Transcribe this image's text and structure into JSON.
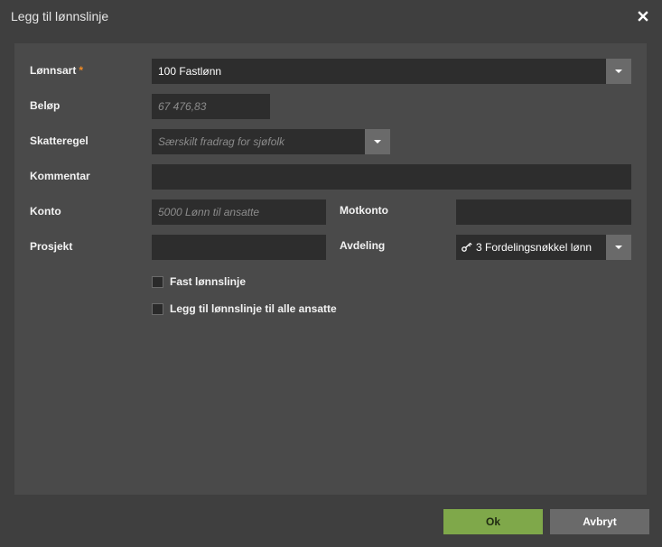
{
  "dialog": {
    "title": "Legg til lønnslinje",
    "close_icon": "close-icon"
  },
  "form": {
    "lonnsart": {
      "label": "Lønnsart",
      "required_marker": "*",
      "value": "100 Fastlønn",
      "dropdown_icon": "chevron-down-icon"
    },
    "belop": {
      "label": "Beløp",
      "placeholder": "67 476,83"
    },
    "skatteregel": {
      "label": "Skatteregel",
      "placeholder": "Særskilt fradrag for sjøfolk",
      "dropdown_icon": "chevron-down-icon"
    },
    "kommentar": {
      "label": "Kommentar",
      "value": ""
    },
    "konto": {
      "label": "Konto",
      "placeholder": "5000 Lønn til ansatte"
    },
    "motkonto": {
      "label": "Motkonto",
      "value": ""
    },
    "prosjekt": {
      "label": "Prosjekt",
      "value": ""
    },
    "avdeling": {
      "label": "Avdeling",
      "value": "3 Fordelingsnøkkel lønn",
      "icon": "key-icon",
      "dropdown_icon": "chevron-down-icon"
    },
    "checkboxes": [
      {
        "label": "Fast lønnslinje",
        "checked": false
      },
      {
        "label": "Legg til lønnslinje til alle ansatte",
        "checked": false
      }
    ]
  },
  "footer": {
    "ok_label": "Ok",
    "cancel_label": "Avbryt"
  },
  "colors": {
    "background": "#3f3f3f",
    "panel": "#4a4a4a",
    "field": "#2d2d2d",
    "accent_ok": "#7fa84a",
    "required": "#f08a24"
  }
}
